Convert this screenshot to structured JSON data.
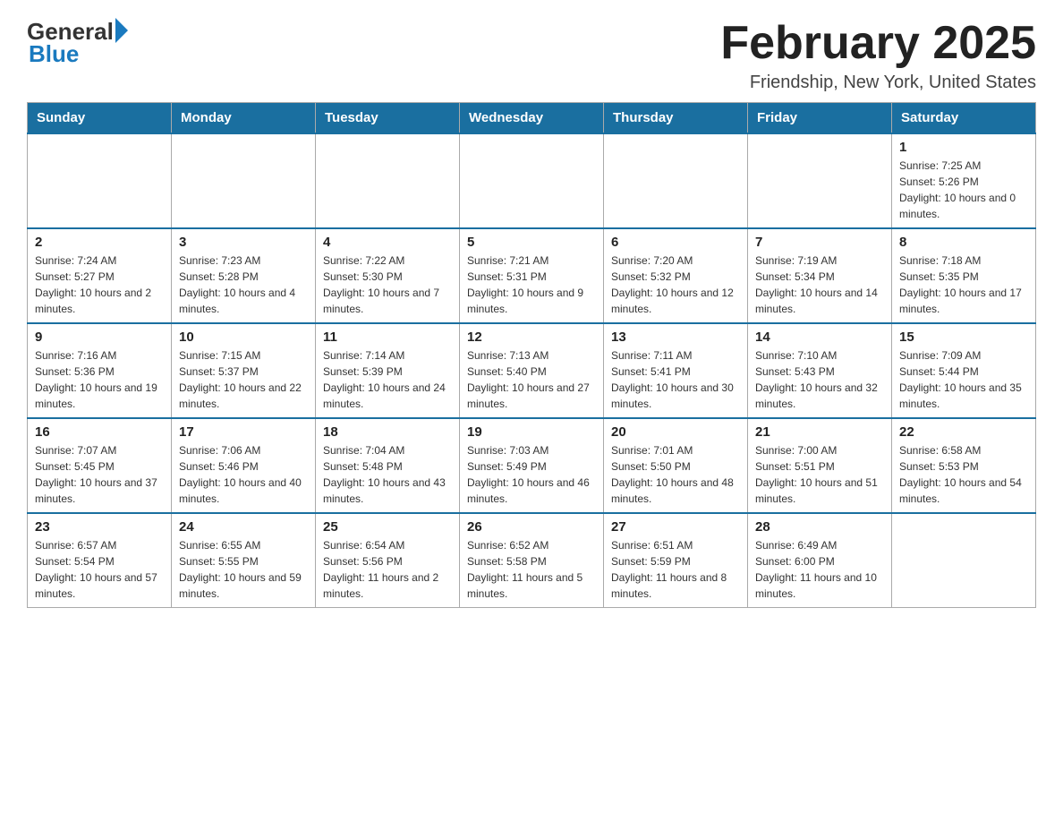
{
  "header": {
    "logo_general": "General",
    "logo_blue": "Blue",
    "month_title": "February 2025",
    "location": "Friendship, New York, United States"
  },
  "days_of_week": [
    "Sunday",
    "Monday",
    "Tuesday",
    "Wednesday",
    "Thursday",
    "Friday",
    "Saturday"
  ],
  "weeks": [
    [
      {
        "day": "",
        "info": ""
      },
      {
        "day": "",
        "info": ""
      },
      {
        "day": "",
        "info": ""
      },
      {
        "day": "",
        "info": ""
      },
      {
        "day": "",
        "info": ""
      },
      {
        "day": "",
        "info": ""
      },
      {
        "day": "1",
        "info": "Sunrise: 7:25 AM\nSunset: 5:26 PM\nDaylight: 10 hours and 0 minutes."
      }
    ],
    [
      {
        "day": "2",
        "info": "Sunrise: 7:24 AM\nSunset: 5:27 PM\nDaylight: 10 hours and 2 minutes."
      },
      {
        "day": "3",
        "info": "Sunrise: 7:23 AM\nSunset: 5:28 PM\nDaylight: 10 hours and 4 minutes."
      },
      {
        "day": "4",
        "info": "Sunrise: 7:22 AM\nSunset: 5:30 PM\nDaylight: 10 hours and 7 minutes."
      },
      {
        "day": "5",
        "info": "Sunrise: 7:21 AM\nSunset: 5:31 PM\nDaylight: 10 hours and 9 minutes."
      },
      {
        "day": "6",
        "info": "Sunrise: 7:20 AM\nSunset: 5:32 PM\nDaylight: 10 hours and 12 minutes."
      },
      {
        "day": "7",
        "info": "Sunrise: 7:19 AM\nSunset: 5:34 PM\nDaylight: 10 hours and 14 minutes."
      },
      {
        "day": "8",
        "info": "Sunrise: 7:18 AM\nSunset: 5:35 PM\nDaylight: 10 hours and 17 minutes."
      }
    ],
    [
      {
        "day": "9",
        "info": "Sunrise: 7:16 AM\nSunset: 5:36 PM\nDaylight: 10 hours and 19 minutes."
      },
      {
        "day": "10",
        "info": "Sunrise: 7:15 AM\nSunset: 5:37 PM\nDaylight: 10 hours and 22 minutes."
      },
      {
        "day": "11",
        "info": "Sunrise: 7:14 AM\nSunset: 5:39 PM\nDaylight: 10 hours and 24 minutes."
      },
      {
        "day": "12",
        "info": "Sunrise: 7:13 AM\nSunset: 5:40 PM\nDaylight: 10 hours and 27 minutes."
      },
      {
        "day": "13",
        "info": "Sunrise: 7:11 AM\nSunset: 5:41 PM\nDaylight: 10 hours and 30 minutes."
      },
      {
        "day": "14",
        "info": "Sunrise: 7:10 AM\nSunset: 5:43 PM\nDaylight: 10 hours and 32 minutes."
      },
      {
        "day": "15",
        "info": "Sunrise: 7:09 AM\nSunset: 5:44 PM\nDaylight: 10 hours and 35 minutes."
      }
    ],
    [
      {
        "day": "16",
        "info": "Sunrise: 7:07 AM\nSunset: 5:45 PM\nDaylight: 10 hours and 37 minutes."
      },
      {
        "day": "17",
        "info": "Sunrise: 7:06 AM\nSunset: 5:46 PM\nDaylight: 10 hours and 40 minutes."
      },
      {
        "day": "18",
        "info": "Sunrise: 7:04 AM\nSunset: 5:48 PM\nDaylight: 10 hours and 43 minutes."
      },
      {
        "day": "19",
        "info": "Sunrise: 7:03 AM\nSunset: 5:49 PM\nDaylight: 10 hours and 46 minutes."
      },
      {
        "day": "20",
        "info": "Sunrise: 7:01 AM\nSunset: 5:50 PM\nDaylight: 10 hours and 48 minutes."
      },
      {
        "day": "21",
        "info": "Sunrise: 7:00 AM\nSunset: 5:51 PM\nDaylight: 10 hours and 51 minutes."
      },
      {
        "day": "22",
        "info": "Sunrise: 6:58 AM\nSunset: 5:53 PM\nDaylight: 10 hours and 54 minutes."
      }
    ],
    [
      {
        "day": "23",
        "info": "Sunrise: 6:57 AM\nSunset: 5:54 PM\nDaylight: 10 hours and 57 minutes."
      },
      {
        "day": "24",
        "info": "Sunrise: 6:55 AM\nSunset: 5:55 PM\nDaylight: 10 hours and 59 minutes."
      },
      {
        "day": "25",
        "info": "Sunrise: 6:54 AM\nSunset: 5:56 PM\nDaylight: 11 hours and 2 minutes."
      },
      {
        "day": "26",
        "info": "Sunrise: 6:52 AM\nSunset: 5:58 PM\nDaylight: 11 hours and 5 minutes."
      },
      {
        "day": "27",
        "info": "Sunrise: 6:51 AM\nSunset: 5:59 PM\nDaylight: 11 hours and 8 minutes."
      },
      {
        "day": "28",
        "info": "Sunrise: 6:49 AM\nSunset: 6:00 PM\nDaylight: 11 hours and 10 minutes."
      },
      {
        "day": "",
        "info": ""
      }
    ]
  ]
}
